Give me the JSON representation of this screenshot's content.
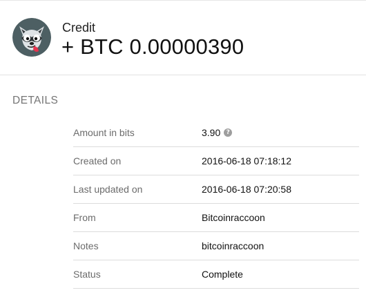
{
  "transaction": {
    "type": "Credit",
    "amount": "+ BTC 0.00000390",
    "avatar_icon": "raccoon-avatar-icon"
  },
  "details": {
    "title": "DETAILS",
    "help_icon_glyph": "?",
    "rows": [
      {
        "label": "Amount in bits",
        "value": "3.90"
      },
      {
        "label": "Created on",
        "value": "2016-06-18 07:18:12"
      },
      {
        "label": "Last updated on",
        "value": "2016-06-18 07:20:58"
      },
      {
        "label": "From",
        "value": "Bitcoinraccoon"
      },
      {
        "label": "Notes",
        "value": "bitcoinraccoon"
      },
      {
        "label": "Status",
        "value": "Complete"
      }
    ]
  },
  "colors": {
    "avatar_background": "#4d5f63",
    "label_text": "#6b6b6b",
    "section_title": "#757575",
    "divider": "#dcdcdc"
  }
}
